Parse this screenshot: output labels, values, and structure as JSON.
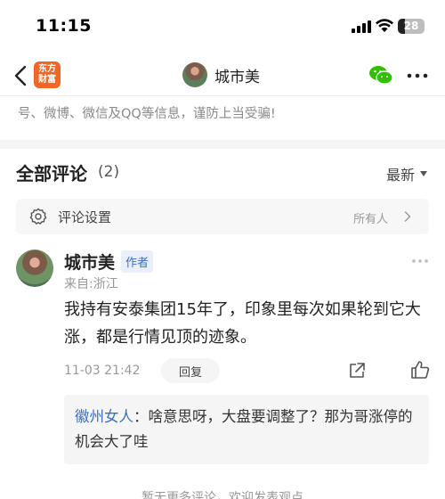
{
  "status": {
    "time": "11:15",
    "battery_level": "28",
    "battery_fraction": 0.28
  },
  "nav": {
    "back_icon": "chevron-left-icon",
    "app_logo_text": "东方\n财富",
    "title": "城市美",
    "share_icon": "wechat-icon",
    "more_icon": "more-horizontal-icon"
  },
  "warning": {
    "text": "号、微博、微信及QQ等信息，谨防上当受骗!"
  },
  "comments": {
    "title": "全部评论",
    "count": "(2)",
    "sort_label": "最新",
    "settings": {
      "label": "评论设置",
      "value": "所有人"
    },
    "items": [
      {
        "author": "城市美",
        "badge": "作者",
        "location": "来自:浙江",
        "text": "我持有安泰集团15年了，印象里每次如果轮到它大涨，都是行情见顶的迹象。",
        "time": "11-03 21:42",
        "reply_label": "回复",
        "reply": {
          "author": "徽州女人",
          "separator": "：",
          "text": "啥意思呀，大盘要调整了？那为哥涨停的机会大了哇"
        }
      }
    ],
    "footer_text": "暂无更多评论，欢迎发表观点"
  },
  "colors": {
    "accent_blue": "#3a6fc4",
    "brand_orange": "#f26522",
    "wechat_green": "#2dc100"
  }
}
